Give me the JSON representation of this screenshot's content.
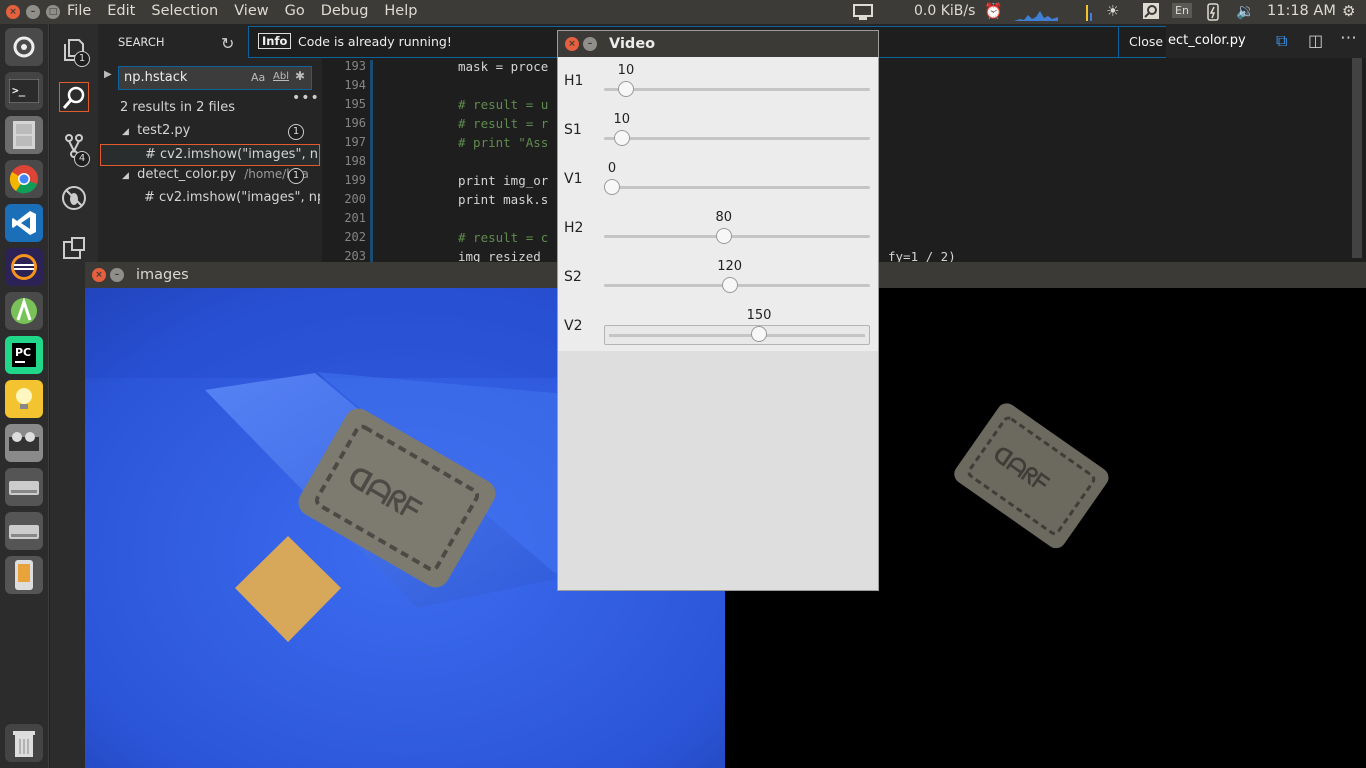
{
  "topbar": {
    "menus": [
      "File",
      "Edit",
      "Selection",
      "View",
      "Go",
      "Debug",
      "Help"
    ],
    "net_speed": "0.0 KiB/s",
    "keyboard": "En",
    "time": "11:18 AM"
  },
  "launcher": {
    "items": [
      "ubuntu-settings",
      "terminal",
      "file-manager",
      "chrome",
      "vscode",
      "eclipse",
      "android-studio",
      "pycharm",
      "idea-bulb",
      "video-app",
      "drive",
      "drive-2",
      "phone-app",
      "trash"
    ]
  },
  "activity": {
    "explorer_badge": "1",
    "scm_badge": "4"
  },
  "sidebar": {
    "title": "SEARCH",
    "query": "np.hstack",
    "opt_case": "Aa",
    "opt_word": "Abl",
    "summary": "2 results in 2 files",
    "files": [
      {
        "name": "test2.py",
        "path": "",
        "count": "1",
        "match": "# cv2.imshow(\"images\", np...."
      },
      {
        "name": "detect_color.py",
        "path": "/home/bha",
        "count": "1",
        "match": "# cv2.imshow(\"images\", np...."
      }
    ],
    "status": "m"
  },
  "notification": {
    "tag": "Info",
    "message": "Code is already running!",
    "close_label": "Close"
  },
  "editor": {
    "tab_name": "ect_color.py",
    "lines": [
      {
        "n": "193",
        "code": "mask = proce",
        "kind": "code"
      },
      {
        "n": "194",
        "code": "",
        "kind": "code"
      },
      {
        "n": "195",
        "code": "# result = u",
        "kind": "comment"
      },
      {
        "n": "196",
        "code": "# result = r",
        "kind": "comment"
      },
      {
        "n": "197",
        "code": "# print \"Ass",
        "kind": "comment"
      },
      {
        "n": "198",
        "code": "",
        "kind": "code"
      },
      {
        "n": "199",
        "code": "print img_or",
        "kind": "code"
      },
      {
        "n": "200",
        "code": "print mask.s",
        "kind": "code"
      },
      {
        "n": "201",
        "code": "",
        "kind": "code"
      },
      {
        "n": "202",
        "code": "# result = c",
        "kind": "comment"
      },
      {
        "n": "203",
        "code": "img_resized",
        "kind": "code"
      }
    ],
    "tail_fragment": "fy=1 / 2)"
  },
  "images_window": {
    "title": "images"
  },
  "video_window": {
    "title": "Video",
    "trackbars": [
      {
        "label": "H1",
        "value": 10,
        "max": 179
      },
      {
        "label": "S1",
        "value": 10,
        "max": 255
      },
      {
        "label": "V1",
        "value": 0,
        "max": 255
      },
      {
        "label": "H2",
        "value": 80,
        "max": 179
      },
      {
        "label": "S2",
        "value": 120,
        "max": 255
      },
      {
        "label": "V2",
        "value": 150,
        "max": 255
      }
    ]
  },
  "colors": {
    "accent": "#0e639c",
    "marker": "#d7a85a",
    "blue_bg": "#2a55dc"
  }
}
